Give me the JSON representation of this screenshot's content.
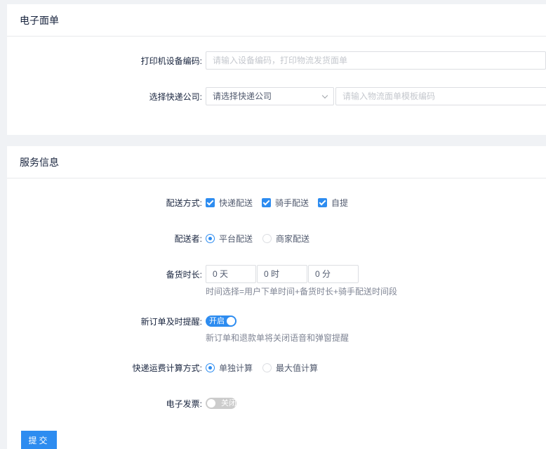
{
  "electronic_waybill": {
    "title": "电子面单",
    "printer_code": {
      "label": "打印机设备编码:",
      "placeholder": "请输入设备编码，打印物流发货面单"
    },
    "courier": {
      "label": "选择快递公司:",
      "select_value": "请选择快递公司",
      "template_placeholder": "请输入物流面单模板编码"
    }
  },
  "service_info": {
    "title": "服务信息",
    "delivery_method": {
      "label": "配送方式:",
      "options": [
        "快递配送",
        "骑手配送",
        "自提"
      ]
    },
    "deliverer": {
      "label": "配送者:",
      "options": [
        "平台配送",
        "商家配送"
      ],
      "selected": 0
    },
    "stock_time": {
      "label": "备货时长:",
      "day": "0 天",
      "hour": "0 时",
      "minute": "0 分",
      "hint": "时间选择=用户下单时间+备货时长+骑手配送时间段"
    },
    "new_order_reminder": {
      "label": "新订单及时提醒:",
      "switch_text": "开启",
      "hint": "新订单和退款单将关闭语音和弹窗提醒"
    },
    "freight_calc": {
      "label": "快递运费计算方式:",
      "options": [
        "单独计算",
        "最大值计算"
      ],
      "selected": 0
    },
    "e_invoice": {
      "label": "电子发票:",
      "switch_text": "关闭"
    }
  },
  "submit_label": "提交",
  "colors": {
    "accent": "#2d8cf0",
    "bg": "#f0f2f5"
  }
}
